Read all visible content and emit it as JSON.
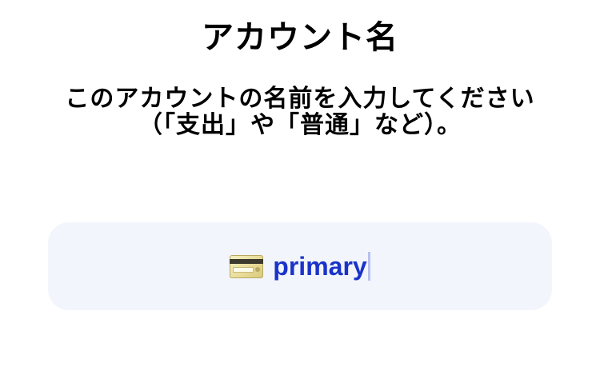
{
  "header": {
    "title": "アカウント名"
  },
  "instructions": {
    "text": "このアカウントの名前を入力してください（「支出」や「普通」など）。"
  },
  "account_name_field": {
    "value": "primary",
    "icon": "credit-card-icon",
    "background": "#f2f5fb",
    "text_color": "#1a33c9"
  }
}
